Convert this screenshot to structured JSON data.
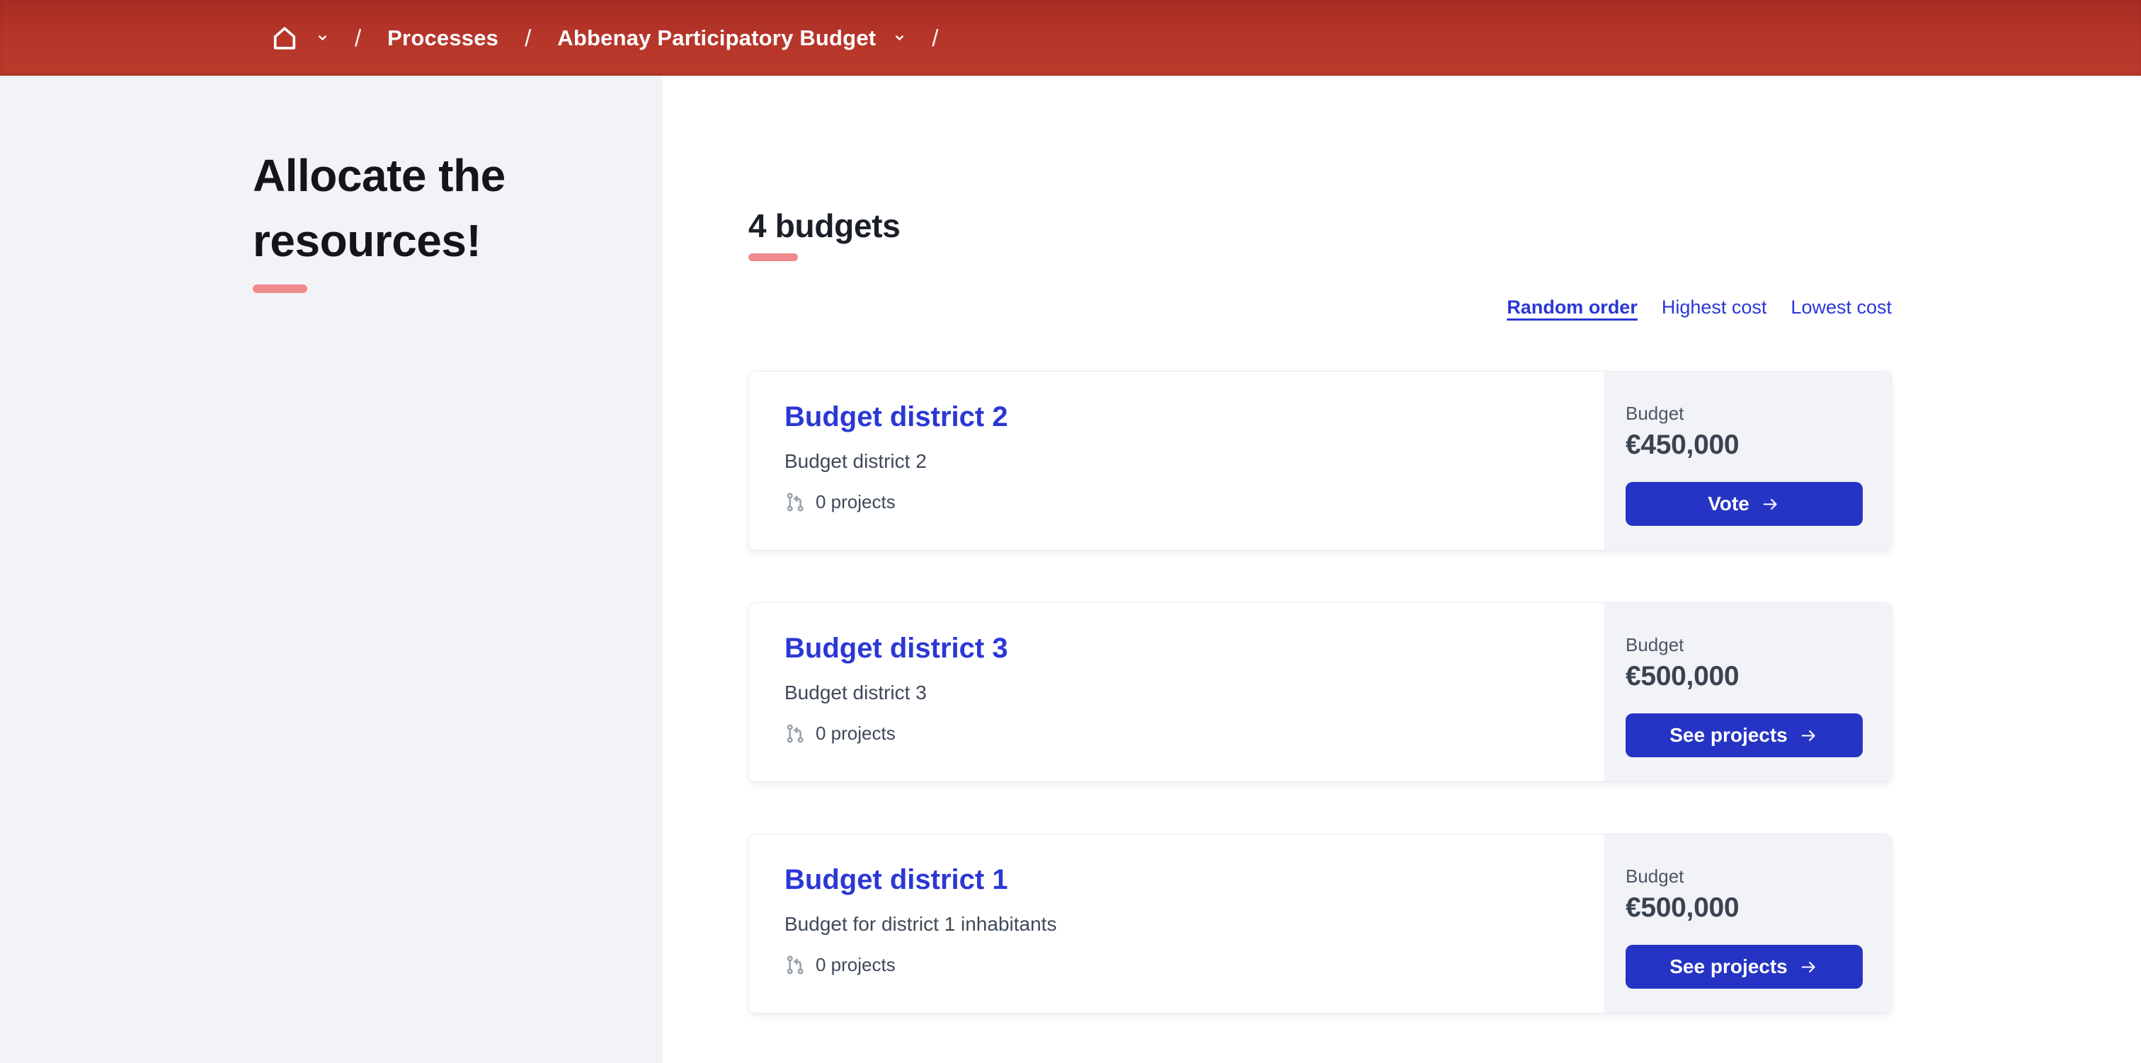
{
  "theme": {
    "header_red": "#b5352a",
    "accent_salmon": "#ef8a8d",
    "link_blue": "#2b38d4",
    "button_blue": "#2534c4",
    "sidebar_gray": "#f2f3f7"
  },
  "breadcrumb": {
    "separator": "/",
    "processes_label": "Processes",
    "process_label": "Abbenay Participatory Budget",
    "icons": [
      "home-icon",
      "chevron-down-icon"
    ]
  },
  "sidebar": {
    "title": "Allocate the resources!"
  },
  "content": {
    "heading": "4 budgets",
    "sort": {
      "options": [
        {
          "label": "Random order",
          "selected": true
        },
        {
          "label": "Highest cost",
          "selected": false
        },
        {
          "label": "Lowest cost",
          "selected": false
        }
      ]
    },
    "cards": [
      {
        "title": "Budget district 2",
        "subtitle": "Budget district 2",
        "projects_count": "0 projects",
        "budget_label": "Budget",
        "amount": "€450,000",
        "button_label": "Vote"
      },
      {
        "title": "Budget district 3",
        "subtitle": "Budget district 3",
        "projects_count": "0 projects",
        "budget_label": "Budget",
        "amount": "€500,000",
        "button_label": "See projects"
      },
      {
        "title": "Budget district 1",
        "subtitle": "Budget for district 1 inhabitants",
        "projects_count": "0 projects",
        "budget_label": "Budget",
        "amount": "€500,000",
        "button_label": "See projects"
      }
    ]
  }
}
